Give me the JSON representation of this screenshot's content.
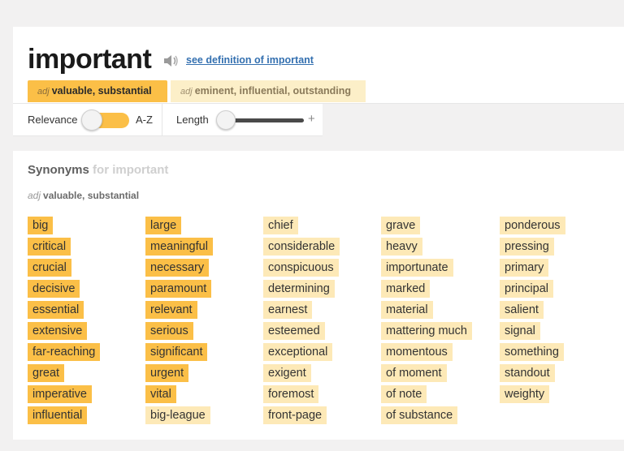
{
  "header": {
    "headword": "important",
    "definition_link": "see definition of important",
    "icons": {
      "speaker": "speaker-icon"
    }
  },
  "tabs": [
    {
      "pos": "adj",
      "label": "valuable, substantial",
      "active": true
    },
    {
      "pos": "adj",
      "label": "eminent, influential, outstanding",
      "active": false
    }
  ],
  "filters": {
    "relevance_label": "Relevance",
    "az_label": "A-Z",
    "length_label": "Length",
    "plus": "+"
  },
  "synonyms": {
    "title": "Synonyms",
    "title_suffix": "for important",
    "sense_pos": "adj",
    "sense_label": "valuable, substantial",
    "columns": [
      [
        "big",
        "critical",
        "crucial",
        "decisive",
        "essential",
        "extensive",
        "far-reaching",
        "great",
        "imperative",
        "influential"
      ],
      [
        "large",
        "meaningful",
        "necessary",
        "paramount",
        "relevant",
        "serious",
        "significant",
        "urgent",
        "vital",
        "big-league"
      ],
      [
        "chief",
        "considerable",
        "conspicuous",
        "determining",
        "earnest",
        "esteemed",
        "exceptional",
        "exigent",
        "foremost",
        "front-page"
      ],
      [
        "grave",
        "heavy",
        "importunate",
        "marked",
        "material",
        "mattering much",
        "momentous",
        "of moment",
        "of note",
        "of substance"
      ],
      [
        "ponderous",
        "pressing",
        "primary",
        "principal",
        "salient",
        "signal",
        "something",
        "standout",
        "weighty"
      ]
    ],
    "strong_count_by_column": [
      10,
      9,
      0,
      0,
      0
    ]
  },
  "colors": {
    "strong": "#fbbf47",
    "weak": "#fde9b7",
    "link": "#3470b0",
    "background": "#f2f1f1"
  }
}
